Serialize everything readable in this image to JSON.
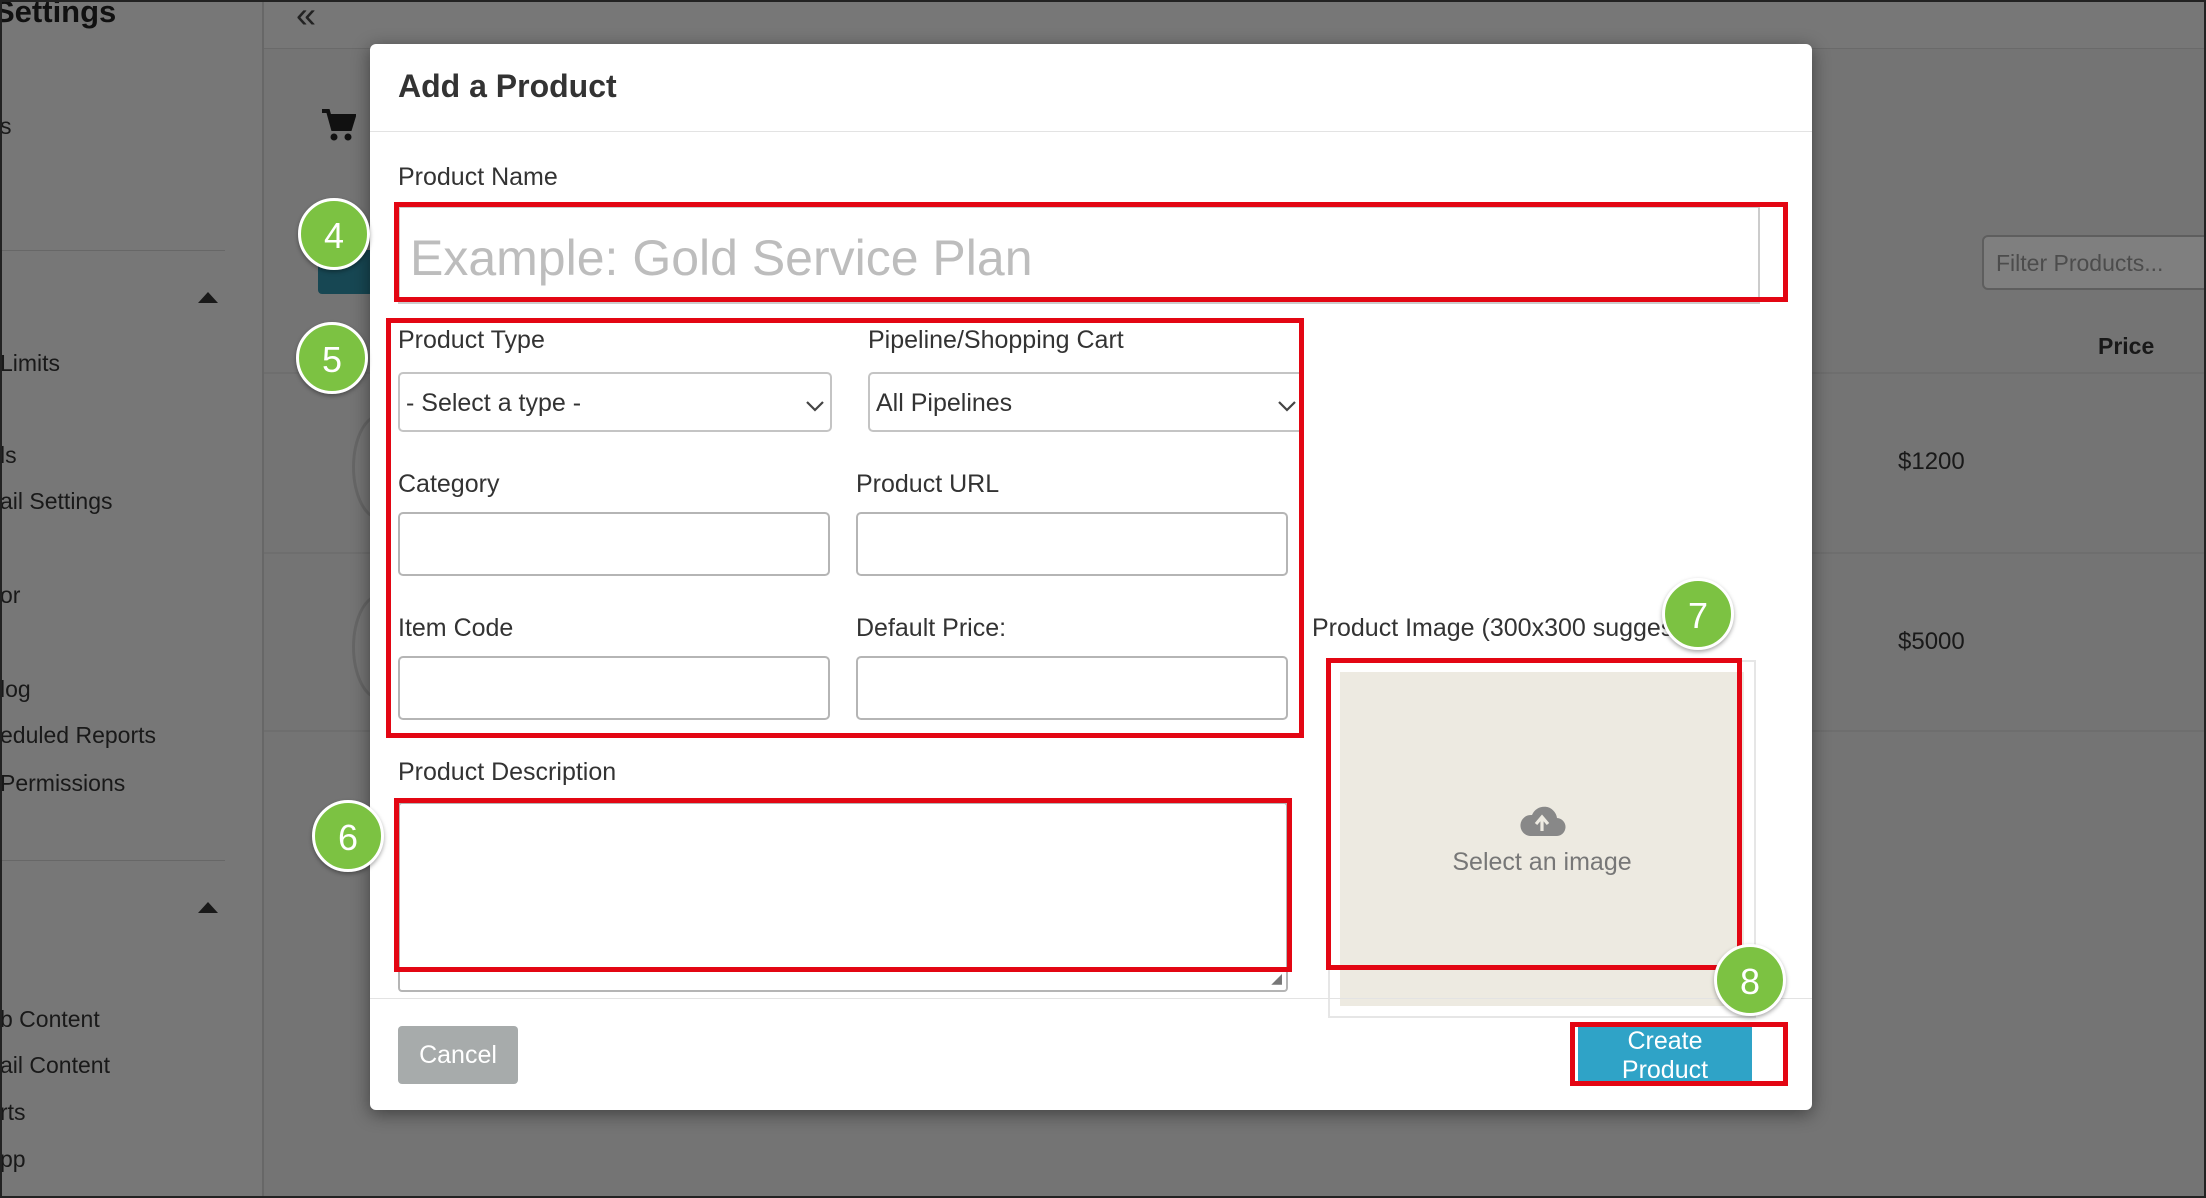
{
  "sidebar": {
    "header": "Settings",
    "items": [
      "s",
      "Limits",
      "ls",
      "ail Settings",
      "or",
      "log",
      "eduled Reports",
      "Permissions",
      "b Content",
      "ail Content",
      "rts",
      "pp"
    ]
  },
  "background": {
    "collapse_icon": "double-chevron-left-icon",
    "cart_icon": "shopping-cart-icon",
    "filter_placeholder": "Filter Products...",
    "price_header": "Price",
    "prices": [
      "$1200",
      "$5000"
    ]
  },
  "modal": {
    "title": "Add a Product",
    "product_name": {
      "label": "Product Name",
      "placeholder": "Example: Gold Service Plan"
    },
    "product_type": {
      "label": "Product Type",
      "selected": "- Select a type -"
    },
    "pipeline": {
      "label": "Pipeline/Shopping Cart",
      "selected": "All Pipelines"
    },
    "category": {
      "label": "Category",
      "value": ""
    },
    "product_url": {
      "label": "Product URL",
      "value": ""
    },
    "item_code": {
      "label": "Item Code",
      "value": ""
    },
    "default_price": {
      "label": "Default Price:",
      "value": ""
    },
    "description": {
      "label": "Product Description",
      "value": ""
    },
    "image": {
      "label": "Product Image (300x300 sugges",
      "prompt": "Select an image",
      "icon": "cloud-upload-icon"
    },
    "cancel_label": "Cancel",
    "create_label": "Create Product"
  },
  "annotations": {
    "color": "#e30613",
    "badge_color": "#7cc242",
    "badges": [
      "4",
      "5",
      "6",
      "7",
      "8"
    ]
  }
}
